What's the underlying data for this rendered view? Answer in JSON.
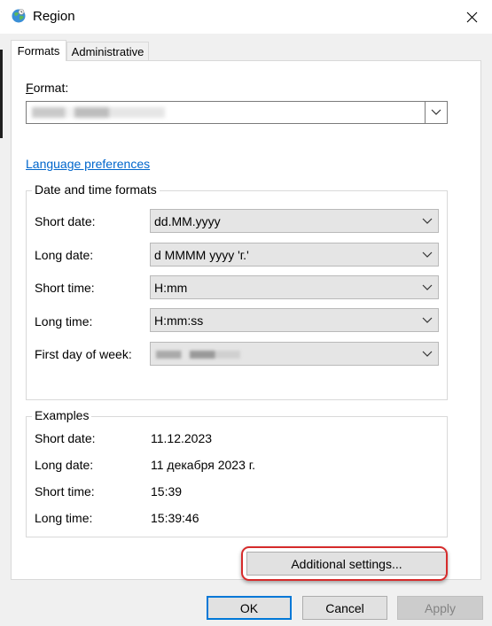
{
  "window": {
    "title": "Region"
  },
  "tabs": [
    {
      "label": "Formats",
      "active": true
    },
    {
      "label": "Administrative",
      "active": false
    }
  ],
  "format": {
    "label": "Format:",
    "value": ""
  },
  "language_preferences_link": "Language preferences",
  "date_time_formats": {
    "legend": "Date and time formats",
    "rows": [
      {
        "label": "Short date:",
        "value": "dd.MM.yyyy"
      },
      {
        "label": "Long date:",
        "value": "d MMMM yyyy 'г.'"
      },
      {
        "label": "Short time:",
        "value": "H:mm"
      },
      {
        "label": "Long time:",
        "value": "H:mm:ss"
      },
      {
        "label": "First day of week:",
        "value": ""
      }
    ]
  },
  "examples": {
    "legend": "Examples",
    "rows": [
      {
        "label": "Short date:",
        "value": "11.12.2023"
      },
      {
        "label": "Long date:",
        "value": "11 декабря 2023 г."
      },
      {
        "label": "Short time:",
        "value": "15:39"
      },
      {
        "label": "Long time:",
        "value": "15:39:46"
      }
    ]
  },
  "buttons": {
    "additional_settings": "Additional settings...",
    "ok": "OK",
    "cancel": "Cancel",
    "apply": "Apply"
  },
  "colors": {
    "link": "#0066cc",
    "highlight": "#d62b2b",
    "default_button_border": "#0078d7"
  }
}
